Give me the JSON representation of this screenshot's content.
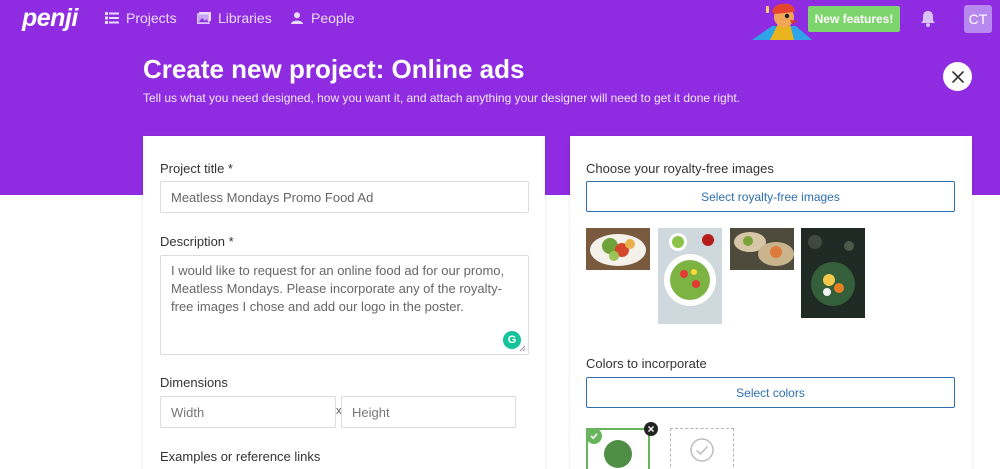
{
  "brand": {
    "logo_text": "penji"
  },
  "nav": {
    "items": [
      {
        "label": "Projects",
        "icon": "list-icon"
      },
      {
        "label": "Libraries",
        "icon": "library-icon"
      },
      {
        "label": "People",
        "icon": "people-icon"
      }
    ]
  },
  "header": {
    "new_features_label": "New features!",
    "avatar_initials": "CT"
  },
  "page": {
    "title": "Create new project: Online ads",
    "subtitle": "Tell us what you need designed, how you want it, and attach anything your designer will need to get it done right."
  },
  "form": {
    "project_title": {
      "label": "Project title *",
      "value": "Meatless Mondays Promo Food Ad"
    },
    "description": {
      "label": "Description *",
      "value": "I would like to request for an online food ad for our promo, Meatless Mondays. Please incorporate any of the royalty-free images I chose and add our logo in the poster."
    },
    "dimensions": {
      "label": "Dimensions",
      "width_placeholder": "Width",
      "separator": "x",
      "height_placeholder": "Height"
    },
    "references": {
      "label": "Examples or reference links"
    }
  },
  "images_section": {
    "label": "Choose your royalty-free images",
    "button_label": "Select royalty-free images"
  },
  "colors_section": {
    "label": "Colors to incorporate",
    "button_label": "Select colors",
    "selected_color": "#4f8f45"
  },
  "colors": {
    "brand_purple": "#8f2be0",
    "accent_green": "#7ed46d",
    "button_blue": "#2e6fb0"
  }
}
